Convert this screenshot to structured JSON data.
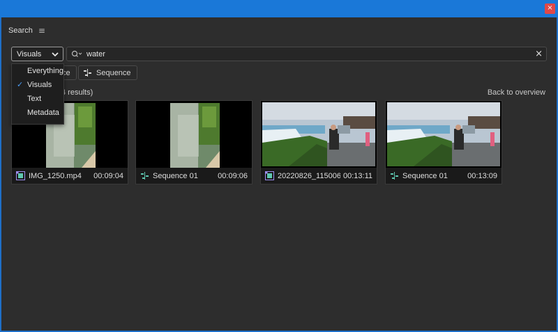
{
  "window": {
    "close_glyph": "×"
  },
  "panel": {
    "title": "Search",
    "menu_glyph": "≡"
  },
  "type_select": {
    "value": "Visuals"
  },
  "search": {
    "value": "water",
    "clear_glyph": "×"
  },
  "filter_chips": [
    {
      "label": "Source Clip",
      "visible_label": "ce",
      "icon": "film-icon"
    },
    {
      "label": "Sequence",
      "icon": "sequence-icon"
    }
  ],
  "results": {
    "label": "4 results)",
    "back_label": "Back to overview"
  },
  "dropdown": {
    "options": [
      {
        "label": "Everything",
        "checked": false
      },
      {
        "label": "Visuals",
        "checked": true
      },
      {
        "label": "Text",
        "checked": false
      },
      {
        "label": "Metadata",
        "checked": false
      }
    ],
    "check_glyph": "✓",
    "check_color": "#4a9cf5"
  },
  "cards": [
    {
      "name": "IMG_1250.mp4",
      "duration": "00:09:04",
      "icon": "clip-icon",
      "thumb": "waterfall-vertical"
    },
    {
      "name": "Sequence 01",
      "duration": "00:09:06",
      "icon": "sequence-icon",
      "thumb": "waterfall-vertical"
    },
    {
      "name": "20220826_115006...",
      "duration": "00:13:11",
      "icon": "clip-icon",
      "thumb": "niagara-falls-person"
    },
    {
      "name": "Sequence 01",
      "duration": "00:13:09",
      "icon": "sequence-icon",
      "thumb": "niagara-falls-person"
    }
  ],
  "colors": {
    "accent": "#1a78d8",
    "close": "#e04848",
    "panel_bg": "#2d2d2d"
  }
}
